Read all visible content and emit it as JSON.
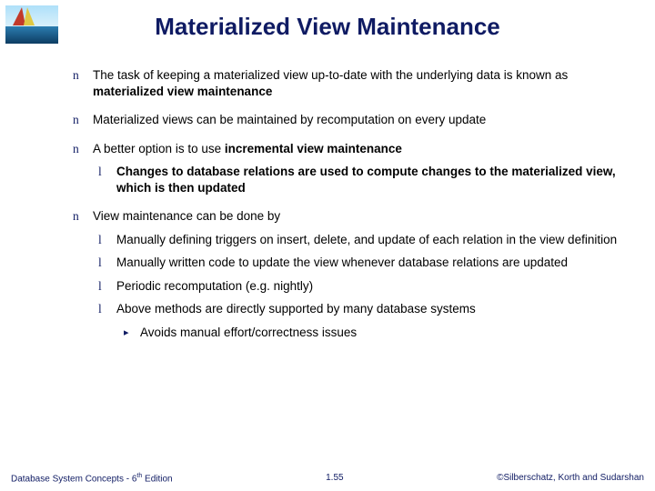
{
  "title": "Materialized View Maintenance",
  "bullets": {
    "b1_pre": "The task of keeping a materialized view up-to-date with the underlying data is known as ",
    "b1_bold": "materialized view maintenance",
    "b2": "Materialized views can be maintained by recomputation on every update",
    "b3_pre": "A better option is to use ",
    "b3_bold": "incremental view maintenance",
    "b3_sub1": "Changes to database relations are used to compute changes to the materialized view, which is then updated",
    "b4": "View maintenance can be done by",
    "b4_sub1": "Manually defining triggers on insert, delete, and update of each relation in the view definition",
    "b4_sub2": "Manually written code to update the view whenever database relations are updated",
    "b4_sub3": "Periodic recomputation (e.g. nightly)",
    "b4_sub4": "Above methods are directly supported by many database systems",
    "b4_sub4_sub": "Avoids manual effort/correctness issues"
  },
  "footer": {
    "left_pre": "Database System Concepts - 6",
    "left_post": " Edition",
    "center": "1.55",
    "right": "©Silberschatz, Korth and Sudarshan"
  },
  "marks": {
    "n": "n",
    "l": "l",
    "t": "▸"
  }
}
